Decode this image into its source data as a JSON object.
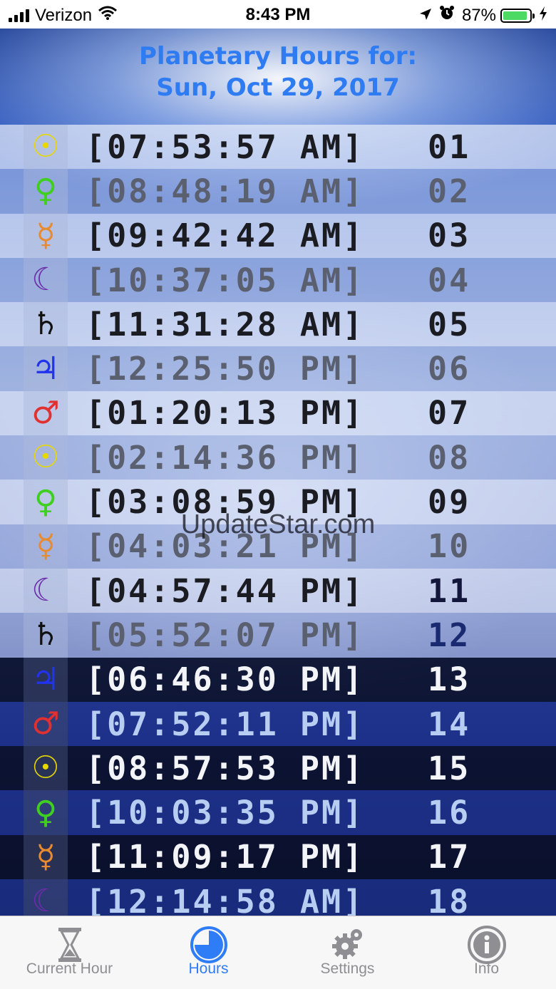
{
  "status_bar": {
    "carrier": "Verizon",
    "time": "8:43 PM",
    "battery": "87%",
    "icons": [
      "signal-icon",
      "wifi-icon",
      "location-icon",
      "alarm-icon",
      "battery-icon",
      "charging-icon"
    ]
  },
  "header": {
    "line1": "Planetary Hours for:",
    "line2": "Sun, Oct 29, 2017"
  },
  "hours": [
    {
      "symbol": "☉",
      "planet": "sun",
      "color": "#e8d800",
      "time": "[07:53:57 AM]",
      "number": "01"
    },
    {
      "symbol": "♀",
      "planet": "venus",
      "color": "#3fcf20",
      "time": "[08:48:19 AM]",
      "number": "02"
    },
    {
      "symbol": "☿",
      "planet": "mercury",
      "color": "#e88a2e",
      "time": "[09:42:42 AM]",
      "number": "03"
    },
    {
      "symbol": "☾",
      "planet": "moon",
      "color": "#6a2ca8",
      "time": "[10:37:05 AM]",
      "number": "04"
    },
    {
      "symbol": "♄",
      "planet": "saturn",
      "color": "#111111",
      "time": "[11:31:28 AM]",
      "number": "05"
    },
    {
      "symbol": "♃",
      "planet": "jupiter",
      "color": "#2233ee",
      "time": "[12:25:50 PM]",
      "number": "06"
    },
    {
      "symbol": "♂",
      "planet": "mars",
      "color": "#e03030",
      "time": "[01:20:13 PM]",
      "number": "07"
    },
    {
      "symbol": "☉",
      "planet": "sun",
      "color": "#e8d800",
      "time": "[02:14:36 PM]",
      "number": "08"
    },
    {
      "symbol": "♀",
      "planet": "venus",
      "color": "#3fcf20",
      "time": "[03:08:59 PM]",
      "number": "09"
    },
    {
      "symbol": "☿",
      "planet": "mercury",
      "color": "#e88a2e",
      "time": "[04:03:21 PM]",
      "number": "10"
    },
    {
      "symbol": "☾",
      "planet": "moon",
      "color": "#6a2ca8",
      "time": "[04:57:44 PM]",
      "number": "11"
    },
    {
      "symbol": "♄",
      "planet": "saturn",
      "color": "#111111",
      "time": "[05:52:07 PM]",
      "number": "12"
    },
    {
      "symbol": "♃",
      "planet": "jupiter",
      "color": "#2233ee",
      "time": "[06:46:30 PM]",
      "number": "13"
    },
    {
      "symbol": "♂",
      "planet": "mars",
      "color": "#e03030",
      "time": "[07:52:11 PM]",
      "number": "14"
    },
    {
      "symbol": "☉",
      "planet": "sun",
      "color": "#e8d800",
      "time": "[08:57:53 PM]",
      "number": "15"
    },
    {
      "symbol": "♀",
      "planet": "venus",
      "color": "#3fcf20",
      "time": "[10:03:35 PM]",
      "number": "16"
    },
    {
      "symbol": "☿",
      "planet": "mercury",
      "color": "#e88a2e",
      "time": "[11:09:17 PM]",
      "number": "17"
    },
    {
      "symbol": "☾",
      "planet": "moon",
      "color": "#6a2ca8",
      "time": "[12:14:58 AM]",
      "number": "18"
    }
  ],
  "watermark": "UpdateStar.com",
  "tabs": [
    {
      "label": "Current Hour",
      "icon": "hourglass-icon",
      "active": false
    },
    {
      "label": "Hours",
      "icon": "clock-icon",
      "active": true
    },
    {
      "label": "Settings",
      "icon": "gear-icon",
      "active": false
    },
    {
      "label": "Info",
      "icon": "info-icon",
      "active": false
    }
  ],
  "colors": {
    "accent": "#2e7cf6",
    "header_text": "#2f7cf2"
  }
}
